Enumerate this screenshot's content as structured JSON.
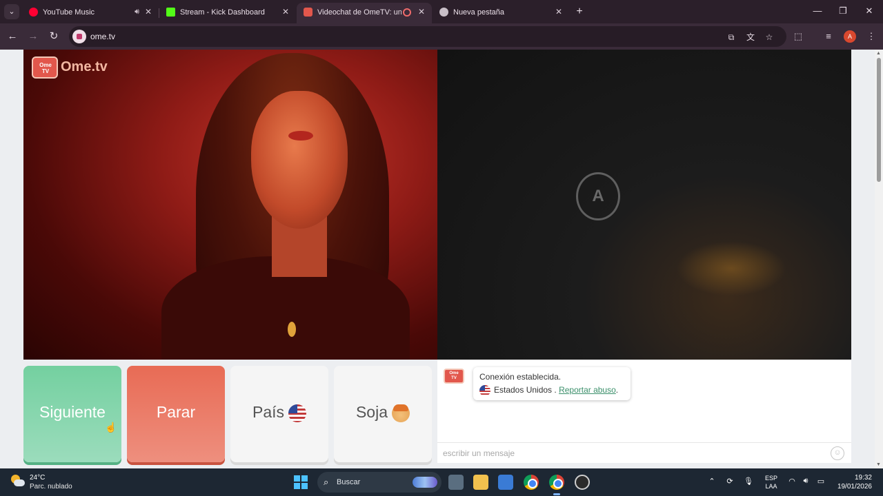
{
  "browser": {
    "tabs": [
      {
        "title": "YouTube Music",
        "favicon_color": "#ff0033",
        "audio": true
      },
      {
        "title": "Stream - Kick Dashboard",
        "favicon_color": "#53fc18"
      },
      {
        "title": "Videochat de OmeTV: una a",
        "favicon_color": "#e2574c",
        "active": true,
        "recording": true
      },
      {
        "title": "Nueva pestaña",
        "favicon_color": "#c8bfc7"
      }
    ],
    "url": "ome.tv"
  },
  "page": {
    "logo_tv_text": "Ome\nTV",
    "logo_text": "Ome.tv",
    "emblem_text": "A",
    "buttons": {
      "next": "Siguiente",
      "stop": "Parar",
      "country": "País",
      "gender": "Soja"
    },
    "chat": {
      "logo_text": "Ome TV",
      "connection_status": "Conexión establecida.",
      "country": "Estados Unidos",
      "separator": " . ",
      "report_link": "Reportar abuso",
      "period": ".",
      "input_placeholder": "escribir un mensaje"
    }
  },
  "taskbar": {
    "temperature": "24°C",
    "condition": "Parc. nublado",
    "search_label": "Buscar",
    "language_top": "ESP",
    "language_bottom": "LAA",
    "time": "19:32",
    "date": "19/01/2026"
  },
  "colors": {
    "next_green": "#74d0a0",
    "stop_red": "#e86b55",
    "brand": "#e2574c",
    "link_green": "#3a8f6a"
  }
}
